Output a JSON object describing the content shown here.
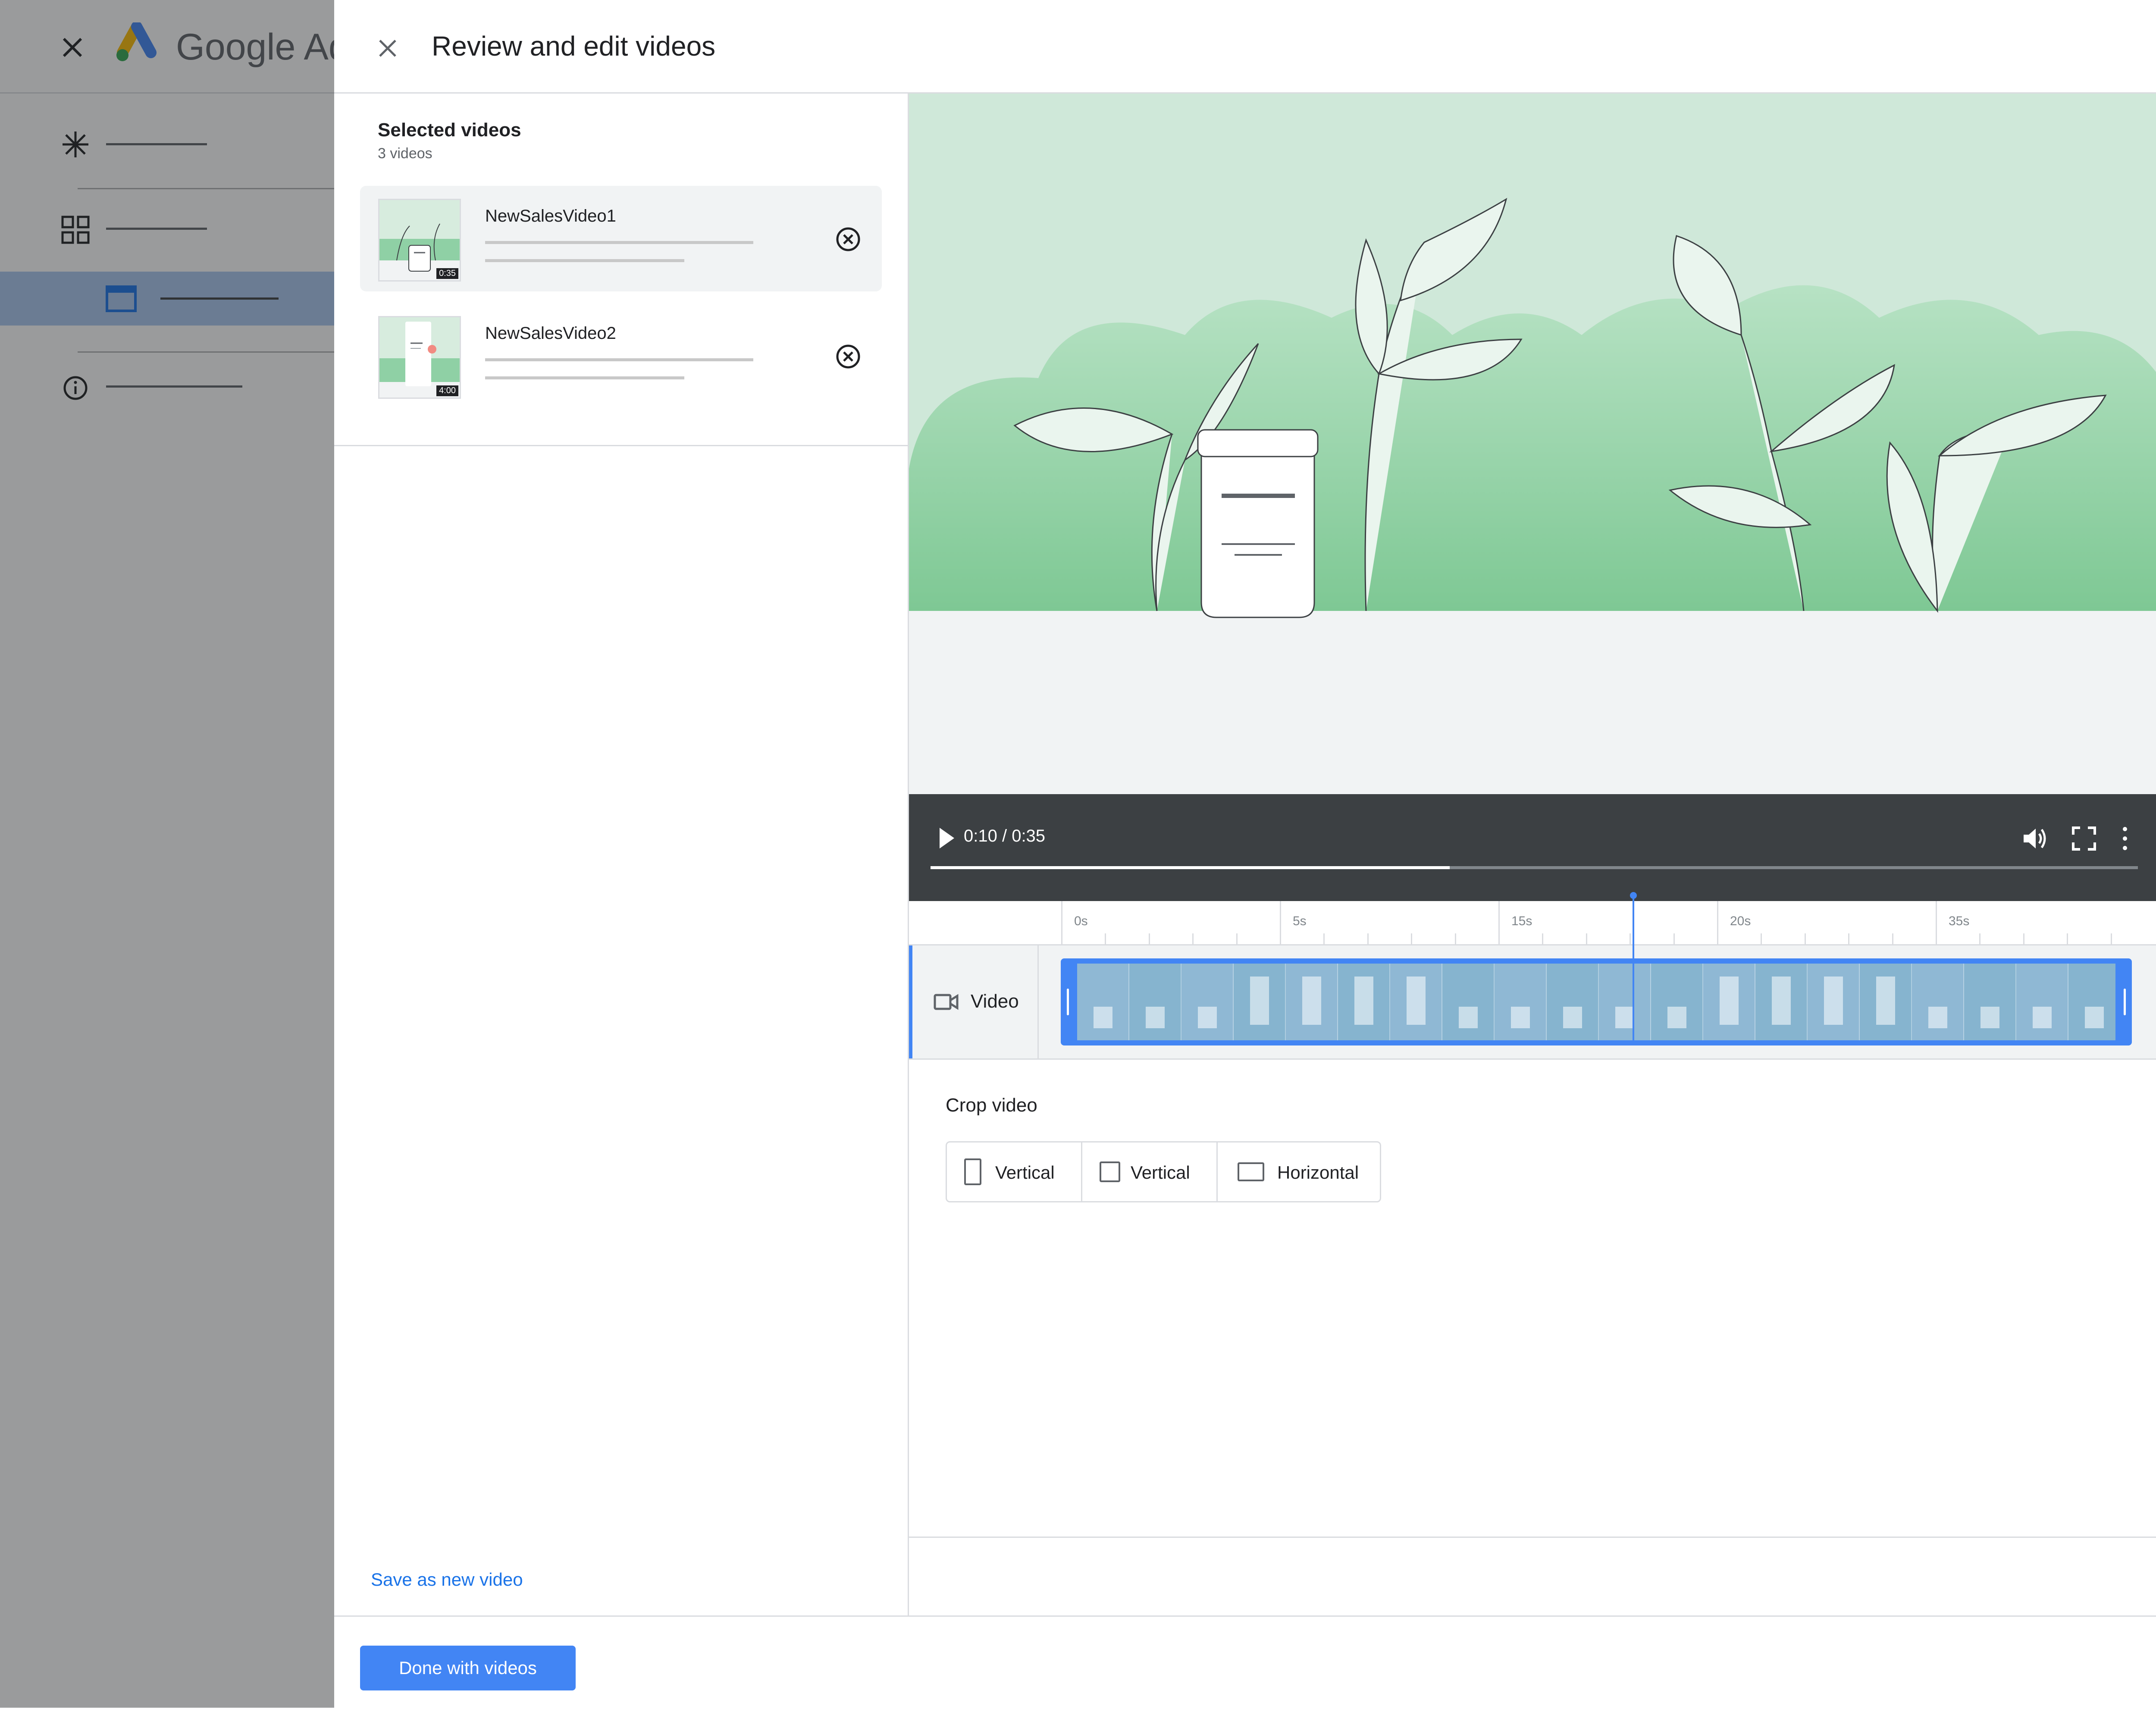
{
  "background_app": {
    "brand_text": "Google Ad",
    "nav_icons": [
      "asterisk-icon",
      "grid-icon",
      "browser-window-icon",
      "info-icon"
    ]
  },
  "dialog": {
    "title": "Review and edit videos"
  },
  "selected": {
    "title": "Selected videos",
    "count": "3 videos",
    "videos": [
      {
        "name": "NewSalesVideo1",
        "duration": "0:35",
        "selected": true
      },
      {
        "name": "NewSalesVideo2",
        "duration": "4:00",
        "selected": false
      }
    ]
  },
  "player": {
    "time": "0:10 / 0:35",
    "progress": 0.43
  },
  "timeline": {
    "ticks": [
      "0s",
      "5s",
      "15s",
      "20s",
      "35s"
    ],
    "track_label": "Video"
  },
  "crop": {
    "title": "Crop video",
    "options": [
      {
        "label": "Vertical",
        "icon": "portrait-icon"
      },
      {
        "label": "Vertical",
        "icon": "square-icon"
      },
      {
        "label": "Horizontal",
        "icon": "landscape-icon"
      }
    ]
  },
  "save_link": "Save as new video",
  "done_button": "Done with videos",
  "colors": {
    "accent": "#4285f4",
    "link": "#1a73e8",
    "player_bar": "#3c4043",
    "preview_bg": "#cfe8d9"
  }
}
